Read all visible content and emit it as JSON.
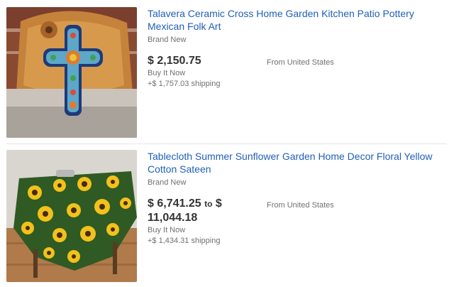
{
  "listings": [
    {
      "title": "Talavera Ceramic Cross Home Garden Kitchen Patio Pottery Mexican Folk Art",
      "condition": "Brand New",
      "price": "$ 2,150.75",
      "format": "Buy It Now",
      "shipping": "+$ 1,757.03 shipping",
      "location": "From United States",
      "image_icon": "talavera-cross-image"
    },
    {
      "title": "Tablecloth Summer Sunflower Garden Home Decor Floral Yellow Cotton Sateen",
      "condition": "Brand New",
      "price_low": "$ 6,741.25",
      "price_to": "to",
      "price_high": "$ 11,044.18",
      "format": "Buy It Now",
      "shipping": "+$ 1,434.31 shipping",
      "location": "From United States",
      "image_icon": "sunflower-tablecloth-image"
    }
  ]
}
